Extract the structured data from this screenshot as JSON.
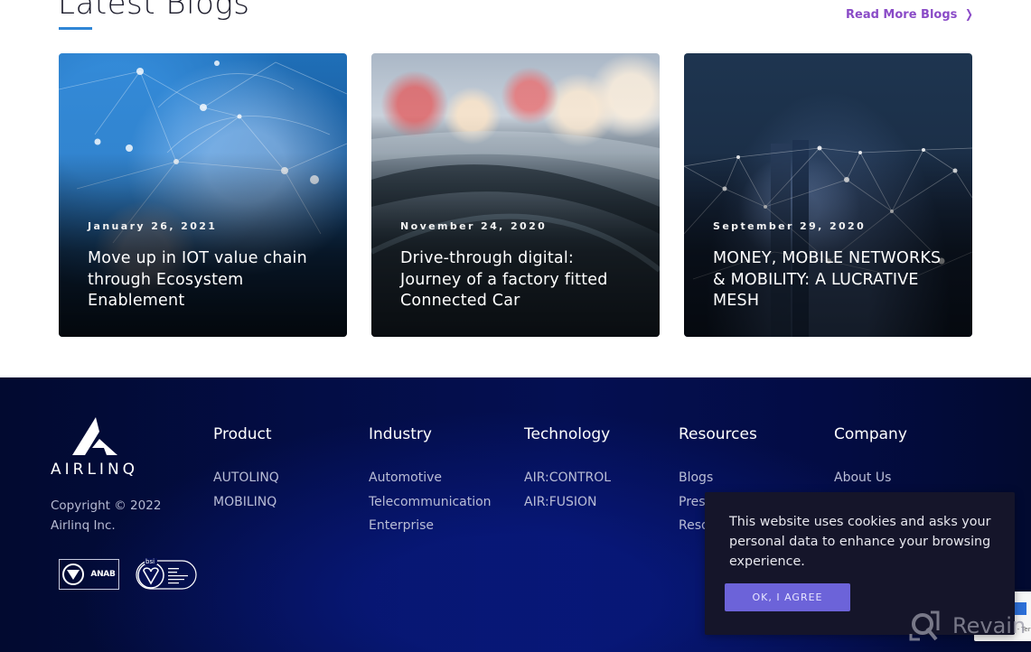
{
  "blog_section": {
    "title": "Latest Blogs",
    "read_more": "Read More Blogs",
    "accent_color": "#2f86d6",
    "link_color": "#8a4bc7",
    "posts": [
      {
        "date": "January 26, 2021",
        "title": "Move up in IOT value chain through Ecosystem Enablement",
        "image": "globe-network-image"
      },
      {
        "date": "November 24, 2020",
        "title": "Drive-through digital: Journey of a factory fitted Connected Car",
        "image": "car-roof-traffic-image"
      },
      {
        "date": "September 29, 2020",
        "title": "MONEY, MOBILE NETWORKS & MOBILITY: A LUCRATIVE MESH",
        "image": "city-night-network-image"
      }
    ]
  },
  "footer": {
    "logo_text": "AIRLINQ",
    "copyright": "Copyright © 2022 Airlinq Inc.",
    "badges": [
      "ANAB",
      "bsi ISO/IEC 27001"
    ],
    "anab_label": "ANAB",
    "columns": [
      {
        "title": "Product",
        "links": [
          "AUTOLINQ",
          "MOBILINQ"
        ]
      },
      {
        "title": "Industry",
        "links": [
          "Automotive",
          "Telecommunication",
          "Enterprise"
        ]
      },
      {
        "title": "Technology",
        "links": [
          "AIR:CONTROL",
          "AIR:FUSION"
        ]
      },
      {
        "title": "Resources",
        "links": [
          "Blogs",
          "Press",
          "Resources"
        ]
      },
      {
        "title": "Company",
        "links": [
          "About Us"
        ]
      }
    ]
  },
  "cookie_banner": {
    "message": "This website uses cookies and asks your personal data to enhance your browsing experience.",
    "accept_label": "OK, I AGREE",
    "button_color": "#6c63d9"
  },
  "recaptcha": {
    "footer_text": "Privacy - Terms"
  },
  "watermark": {
    "text": "Revain"
  }
}
